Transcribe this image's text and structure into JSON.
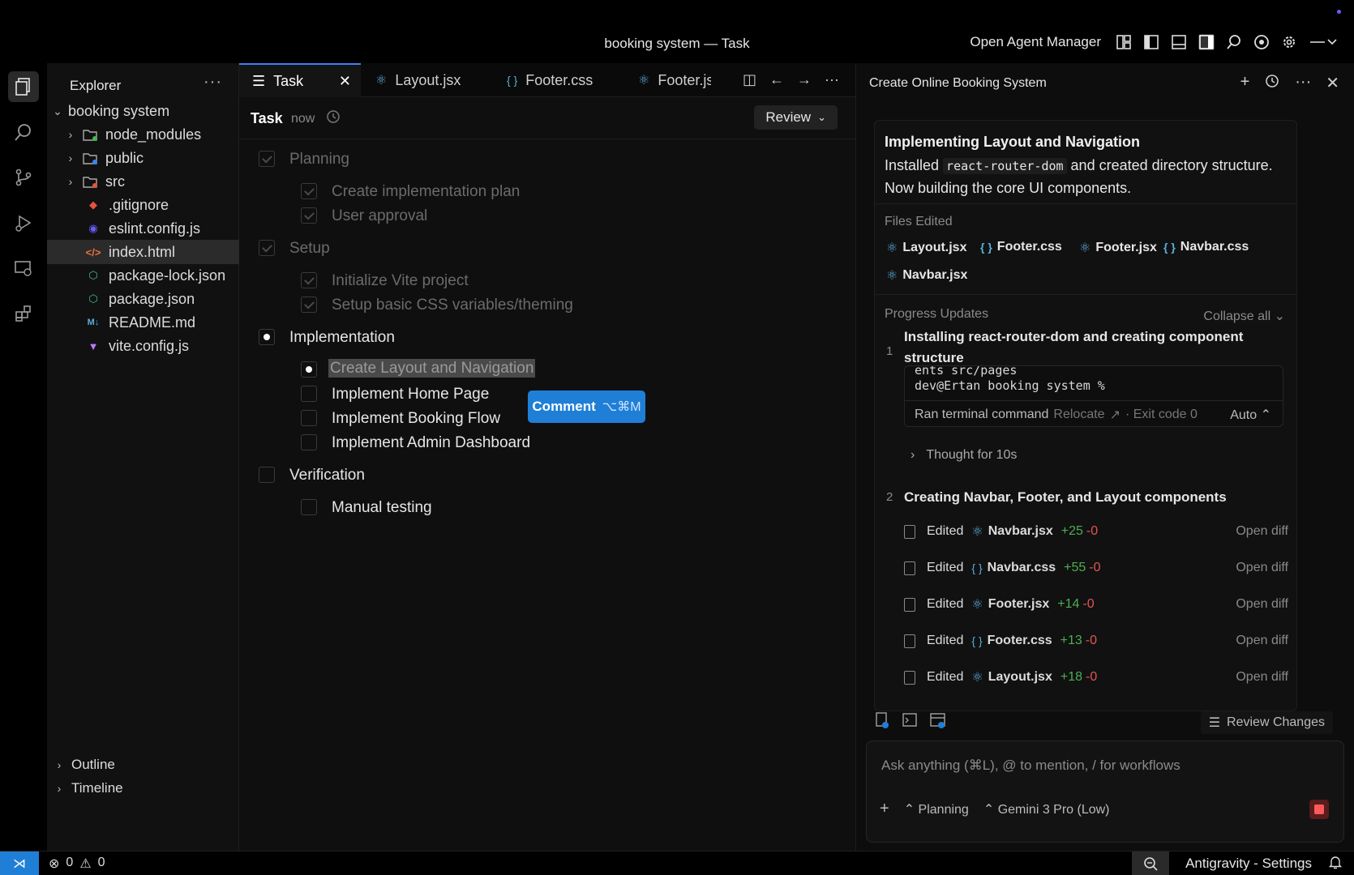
{
  "window": {
    "title": "booking system — Task"
  },
  "topbar": {
    "agent_manager_label": "Open Agent Manager"
  },
  "explorer": {
    "header": "Explorer",
    "more": "···",
    "root": "booking system",
    "items": [
      {
        "name": "node_modules",
        "kind": "folder"
      },
      {
        "name": "public",
        "kind": "folder"
      },
      {
        "name": "src",
        "kind": "folder"
      },
      {
        "name": ".gitignore",
        "kind": "git"
      },
      {
        "name": "eslint.config.js",
        "kind": "eslint"
      },
      {
        "name": "index.html",
        "kind": "html",
        "selected": true
      },
      {
        "name": "package-lock.json",
        "kind": "json"
      },
      {
        "name": "package.json",
        "kind": "json"
      },
      {
        "name": "README.md",
        "kind": "md"
      },
      {
        "name": "vite.config.js",
        "kind": "vite"
      }
    ],
    "outline": "Outline",
    "timeline": "Timeline"
  },
  "tabs": [
    {
      "label": "Task",
      "active": true,
      "icon": "checklist-icon"
    },
    {
      "label": "Layout.jsx",
      "icon": "react-icon"
    },
    {
      "label": "Footer.css",
      "icon": "braces-icon"
    },
    {
      "label": "Footer.js",
      "icon": "react-icon"
    }
  ],
  "task": {
    "title": "Task",
    "time": "now",
    "review_label": "Review",
    "sections": [
      {
        "label": "Planning",
        "state": "done",
        "items": [
          {
            "label": "Create implementation plan",
            "state": "done"
          },
          {
            "label": "User approval",
            "state": "done"
          }
        ]
      },
      {
        "label": "Setup",
        "state": "done",
        "items": [
          {
            "label": "Initialize Vite project",
            "state": "done"
          },
          {
            "label": "Setup basic CSS variables/theming",
            "state": "done"
          }
        ]
      },
      {
        "label": "Implementation",
        "state": "current",
        "items": [
          {
            "label": "Create Layout and Navigation",
            "state": "current"
          },
          {
            "label": "Implement Home Page",
            "state": "open"
          },
          {
            "label": "Implement Booking Flow",
            "state": "open"
          },
          {
            "label": "Implement Admin Dashboard",
            "state": "open"
          }
        ]
      },
      {
        "label": "Verification",
        "state": "open",
        "items": [
          {
            "label": "Manual testing",
            "state": "open"
          }
        ]
      }
    ],
    "comment": {
      "label": "Comment",
      "shortcut": "⌥⌘M"
    }
  },
  "agent": {
    "title": "Create Online Booking System",
    "card": {
      "heading": "Implementing Layout and Navigation",
      "desc_1": "Installed ",
      "desc_code": "react-router-dom",
      "desc_2": " and created directory structure. Now building the core UI components.",
      "files_edited_label": "Files Edited",
      "files_edited": [
        {
          "name": "Layout.jsx",
          "icon": "react-icon"
        },
        {
          "name": "Footer.css",
          "icon": "braces-icon"
        },
        {
          "name": "Footer.jsx",
          "icon": "react-icon"
        },
        {
          "name": "Navbar.css",
          "icon": "braces-icon"
        },
        {
          "name": "Navbar.jsx",
          "icon": "react-icon"
        }
      ],
      "progress_label": "Progress Updates",
      "collapse_all": "Collapse all",
      "steps": [
        {
          "num": "1",
          "title": "Installing react-router-dom and creating component structure"
        },
        {
          "num": "2",
          "title": "Creating Navbar, Footer, and Layout components"
        }
      ],
      "terminal": {
        "line1": "ents src/pages",
        "line2": "dev@Ertan booking system %",
        "ran": "Ran terminal command",
        "relocate": "Relocate",
        "exit": "· Exit code 0",
        "auto": "Auto"
      },
      "thought": "Thought for 10s",
      "edits": [
        {
          "verb": "Edited",
          "file": "Navbar.jsx",
          "icon": "react-icon",
          "add": "+25",
          "del": "-0",
          "action": "Open diff"
        },
        {
          "verb": "Edited",
          "file": "Navbar.css",
          "icon": "braces-icon",
          "add": "+55",
          "del": "-0",
          "action": "Open diff"
        },
        {
          "verb": "Edited",
          "file": "Footer.jsx",
          "icon": "react-icon",
          "add": "+14",
          "del": "-0",
          "action": "Open diff"
        },
        {
          "verb": "Edited",
          "file": "Footer.css",
          "icon": "braces-icon",
          "add": "+13",
          "del": "-0",
          "action": "Open diff"
        },
        {
          "verb": "Edited",
          "file": "Layout.jsx",
          "icon": "react-icon",
          "add": "+18",
          "del": "-0",
          "action": "Open diff"
        }
      ]
    },
    "review_changes": "Review Changes",
    "input_placeholder": "Ask anything (⌘L), @ to mention, / for workflows",
    "mode": "Planning",
    "model": "Gemini 3 Pro (Low)"
  },
  "statusbar": {
    "errors": "0",
    "warnings": "0",
    "settings_label": "Antigravity - Settings"
  }
}
